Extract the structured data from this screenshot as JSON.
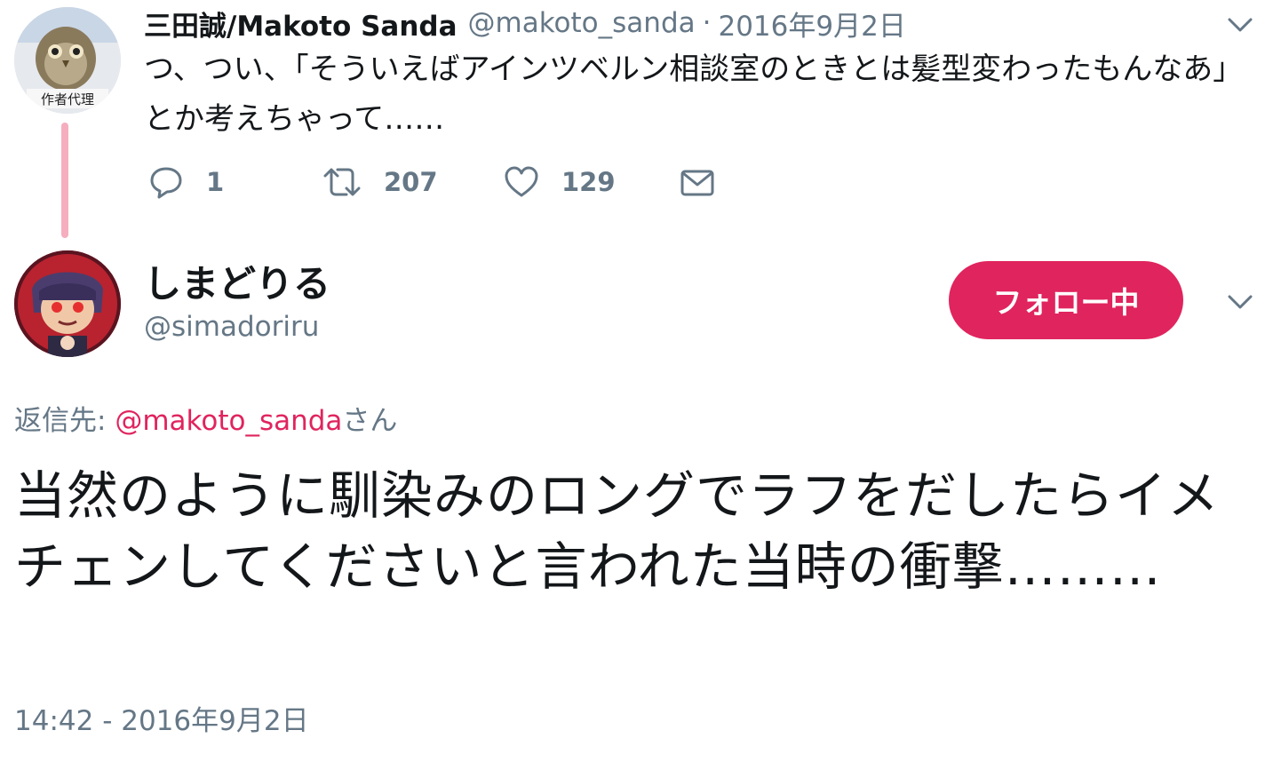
{
  "parent_tweet": {
    "author_name": "三田誠/Makoto Sanda",
    "author_handle": "@makoto_sanda",
    "separator": "·",
    "date": "2016年9月2日",
    "text": "つ、つい、「そういえばアインツベルン相談室のときとは髪型変わったもんなあ」とか考えちゃって……",
    "reply_count": "1",
    "retweet_count": "207",
    "like_count": "129",
    "avatar_caption": "作者代理"
  },
  "main_tweet": {
    "author_name": "しまどりる",
    "author_handle": "@simadoriru",
    "follow_label": "フォロー中",
    "reply_prefix": "返信先: ",
    "reply_mention": "@makoto_sanda",
    "reply_suffix": "さん",
    "text": "当然のように馴染みのロングでラフをだしたらイメチェンしてくださいと言われた当時の衝撃………",
    "timestamp": "14:42 - 2016年9月2日"
  },
  "icons": {
    "reply": "reply-icon",
    "retweet": "retweet-icon",
    "like": "heart-icon",
    "dm": "envelope-icon",
    "menu": "chevron-down-icon"
  },
  "colors": {
    "accent": "#e0245e",
    "secondary_text": "#657786",
    "thread_line": "#f4aebe"
  }
}
